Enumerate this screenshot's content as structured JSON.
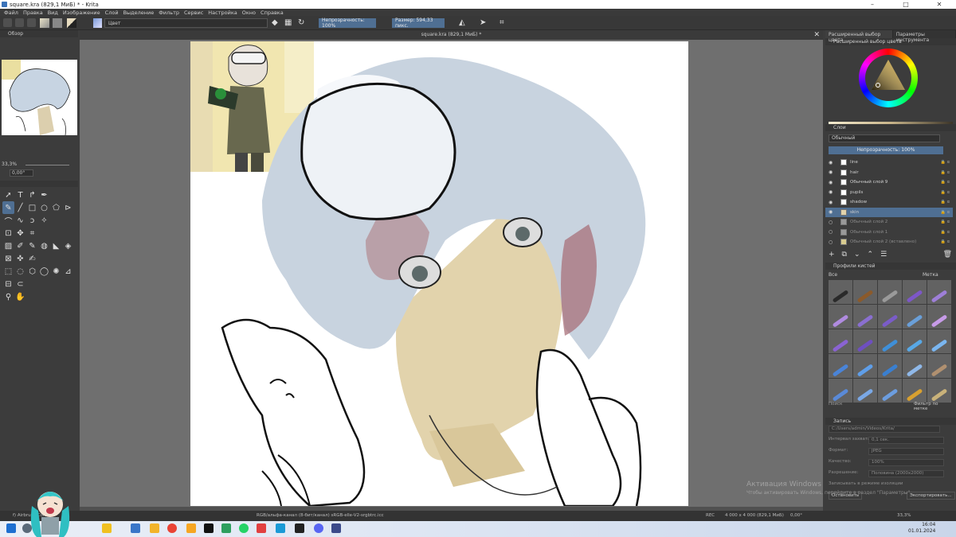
{
  "window": {
    "title": "square.kra (829,1 МиБ) * - Krita"
  },
  "menu": [
    "Файл",
    "Правка",
    "Вид",
    "Изображение",
    "Слой",
    "Выделение",
    "Фильтр",
    "Сервис",
    "Настройка",
    "Окно",
    "Справка"
  ],
  "toolbar": {
    "brush_preset": "Цвет",
    "opacity": "Непрозрачность: 100%",
    "size": "Размер: 594,33 пикс."
  },
  "overview": {
    "title": "Обзор",
    "zoom": "33,3%",
    "rotation": "0,00°"
  },
  "document": {
    "tab": "square.kra (829,1 МиБ) *"
  },
  "right_tabs": [
    "Расширенный выбор цвета",
    "Параметры инструмента"
  ],
  "color_panel": {
    "title": "Расширенный выбор цвета"
  },
  "layers_panel": {
    "title": "Слои",
    "blend_mode": "Обычный",
    "opacity": "Непрозрачность: 100%",
    "layers": [
      {
        "name": "line",
        "visible": true
      },
      {
        "name": "hair",
        "visible": true
      },
      {
        "name": "Обычный слой 9",
        "visible": true
      },
      {
        "name": "pupils",
        "visible": true
      },
      {
        "name": "shadow",
        "visible": true
      },
      {
        "name": "skin",
        "visible": true,
        "selected": true
      },
      {
        "name": "Обычный слой 2",
        "visible": false
      },
      {
        "name": "Обычный слой 1",
        "visible": false
      },
      {
        "name": "Обычный слой 2 (вставлено)",
        "visible": false
      }
    ]
  },
  "brush_panel": {
    "title": "Профили кистей",
    "filter": "Все",
    "tag": "Метка",
    "search_label": "Поиск",
    "filter_by_tag": "Фильтр по метке",
    "brush_colors": [
      "#2a2a2a",
      "#8b5a2b",
      "#9a9a9a",
      "#7d57c8",
      "#9e7fd8",
      "#b08be0",
      "#8a6fd0",
      "#7a5cc8",
      "#6a9fd8",
      "#c79be8",
      "#8a63d2",
      "#6e4fc0",
      "#3f8fd8",
      "#58a8e6",
      "#7ab6f0",
      "#4a84d8",
      "#5f9ee8",
      "#3a7fd0",
      "#8fb8e8",
      "#b09070",
      "#5a8ad8",
      "#7aa8e6",
      "#6c9ddf",
      "#d8a030",
      "#c9b27a"
    ]
  },
  "recorder": {
    "title": "Запись",
    "path_placeholder": "C:/Users/admin/Videos/Krita/",
    "interval_label": "Интервал захвата:",
    "interval_value": "0,1 сек.",
    "format_label": "Формат:",
    "format_value": "JPEG",
    "quality_label": "Качество:",
    "quality_value": "100%",
    "resolution_label": "Разрешение:",
    "resolution_value": "Половина (2000x2000)",
    "record_in_isolation": "Записывать в режиме изоляции",
    "stop_button": "Остановить",
    "export_button": "Экспортировать..."
  },
  "status": {
    "left": "f) Airbrush Color",
    "color_info": "RGB/альфа-канал (8-бит/канал) sRGB-elle-V2-srgbtrc.icc",
    "rec": "REC",
    "size": "4 000 x 4 000 (829,1 МиБ)",
    "rotation": "0,00°",
    "zoom": "33,3%"
  },
  "watermark": {
    "title": "Активация Windows",
    "body": "Чтобы активировать Windows, перейдите в раздел \"Параметры\"."
  },
  "taskbar": {
    "time": "16:04",
    "date": "01.01.2024"
  },
  "app_colors": {
    "accent": "#4f6f93",
    "panel": "#3c3c3c",
    "canvas_bg": "#6f6f6f"
  }
}
